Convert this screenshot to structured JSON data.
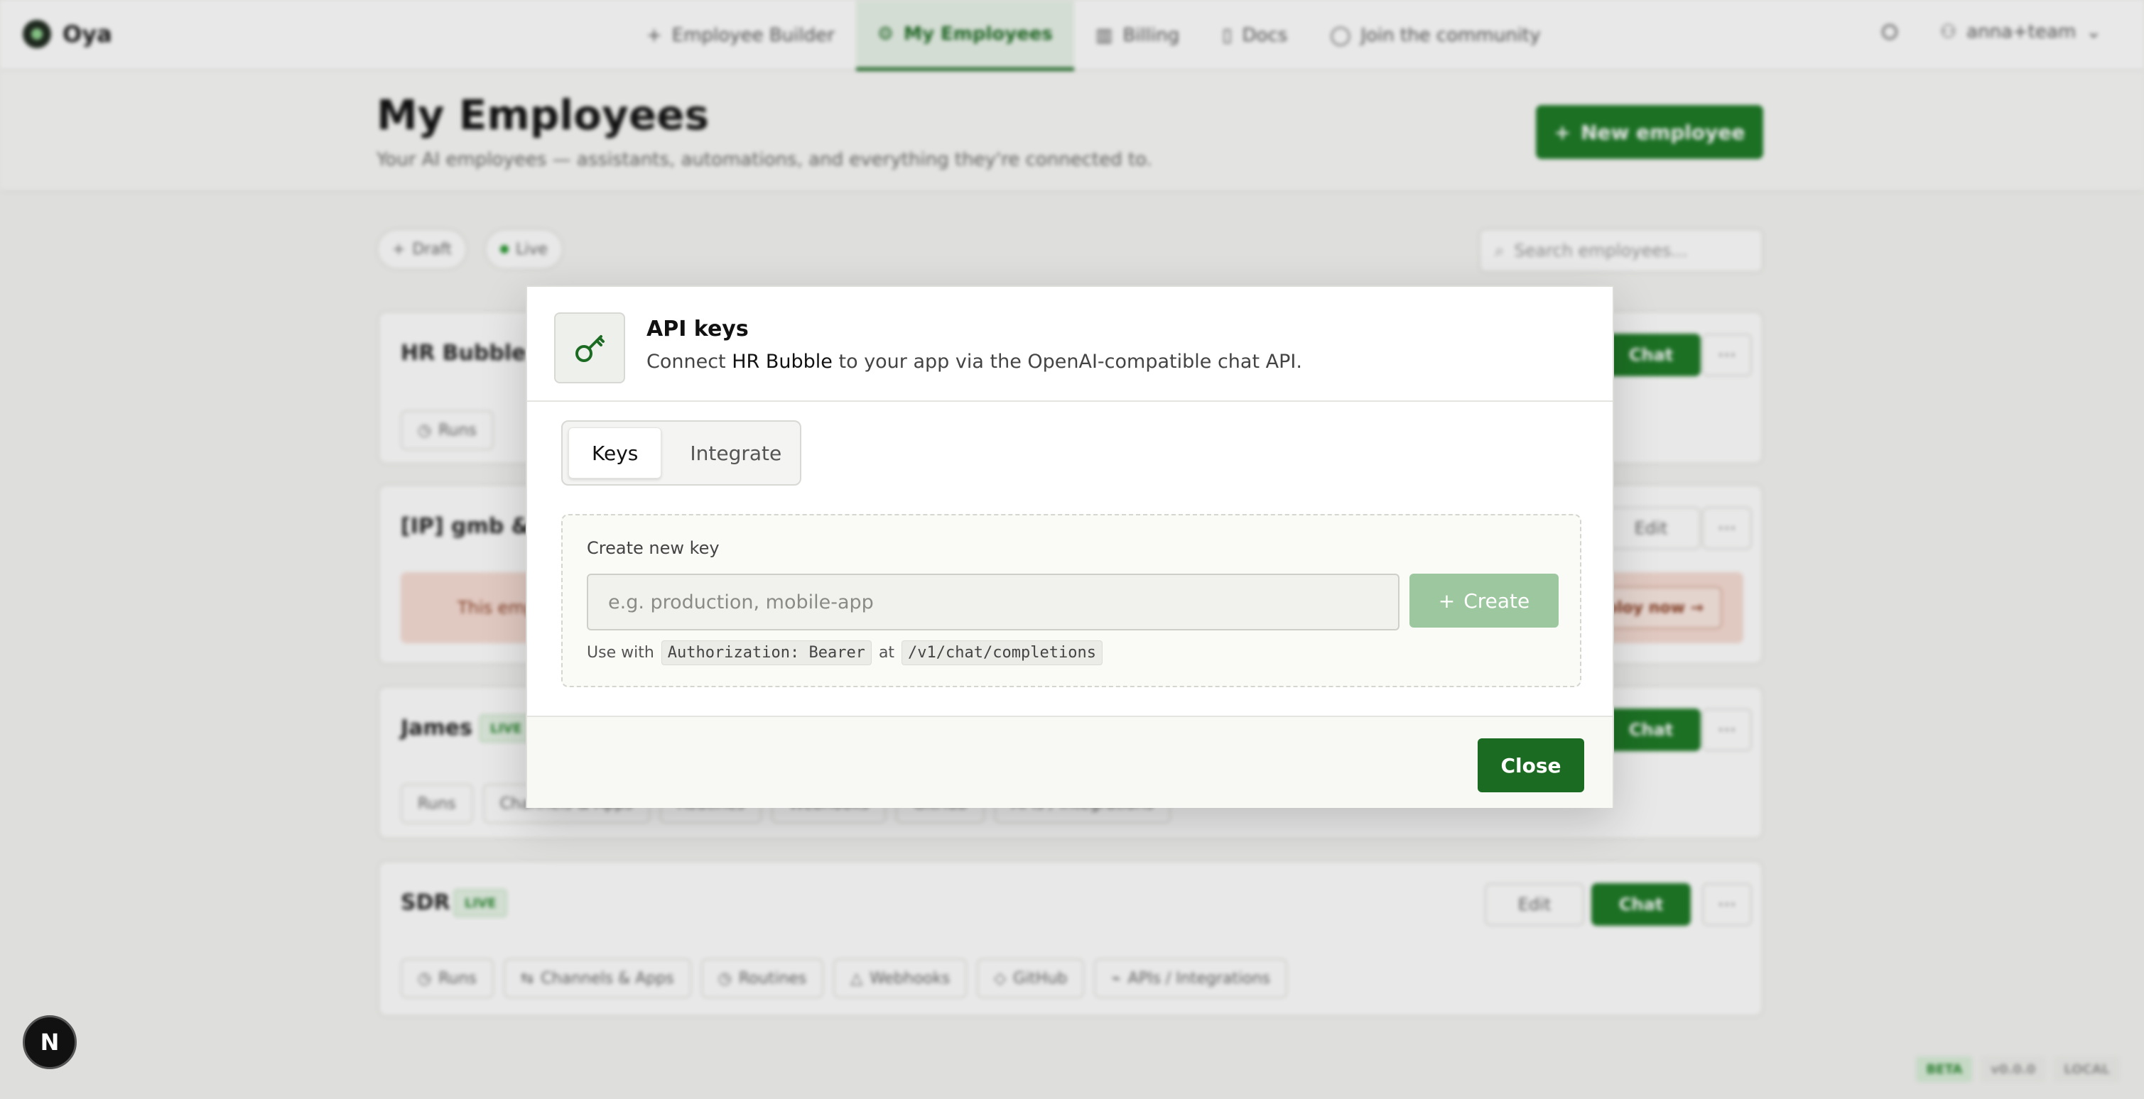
{
  "app": {
    "name": "Oya"
  },
  "nav": {
    "tabs": [
      {
        "label": "Employee Builder",
        "icon": "plus-icon"
      },
      {
        "label": "My Employees",
        "icon": "robot-icon",
        "active": true
      },
      {
        "label": "Billing",
        "icon": "chart-icon"
      },
      {
        "label": "Docs",
        "icon": "book-icon"
      },
      {
        "label": "Join the community",
        "icon": "chat-icon"
      }
    ],
    "user": "anna+team"
  },
  "page": {
    "title": "My Employees",
    "subtitle": "Your AI employees — assistants, automations, and everything they're connected to.",
    "new_button": "New employee",
    "filters": {
      "draft": "Draft",
      "live": "Live"
    },
    "search_placeholder": "Search employees..."
  },
  "cards": [
    {
      "name": "HR Bubble",
      "chat": "Chat",
      "chips": [
        "Runs"
      ]
    },
    {
      "name": "[IP] gmb & w",
      "edit": "Edit",
      "warning": "This emp",
      "warning_action": "ploy now →"
    },
    {
      "name": "James",
      "badge": "LIVE",
      "chat": "Chat",
      "chips": [
        "Runs",
        "Channels & Apps",
        "Routines",
        "Webhooks",
        "GitHub",
        "APIs / Integrations"
      ]
    },
    {
      "name": "SDR",
      "badge": "LIVE",
      "edit": "Edit",
      "chat": "Chat",
      "chips": [
        "Runs",
        "Channels & Apps",
        "Routines",
        "Webhooks",
        "GitHub",
        "APIs / Integrations"
      ]
    }
  ],
  "modal": {
    "title": "API keys",
    "desc_prefix": "Connect",
    "employee": "HR Bubble",
    "desc_suffix": "to your app via the OpenAI-compatible chat API.",
    "tabs": {
      "keys": "Keys",
      "integrate": "Integrate"
    },
    "create_label": "Create new key",
    "input_placeholder": "e.g. production, mobile-app",
    "create_button": "Create",
    "usage_prefix": "Use with",
    "usage_header": "Authorization: Bearer",
    "usage_at": "at",
    "usage_path": "/v1/chat/completions",
    "close_button": "Close"
  },
  "footer": {
    "beta": "BETA",
    "version": "v0.0.0",
    "env": "LOCAL"
  },
  "fab": "N",
  "colors": {
    "brand_green": "#1c6b22",
    "create_disabled": "#9dc79f",
    "warn_bg": "#f7ddd4"
  }
}
